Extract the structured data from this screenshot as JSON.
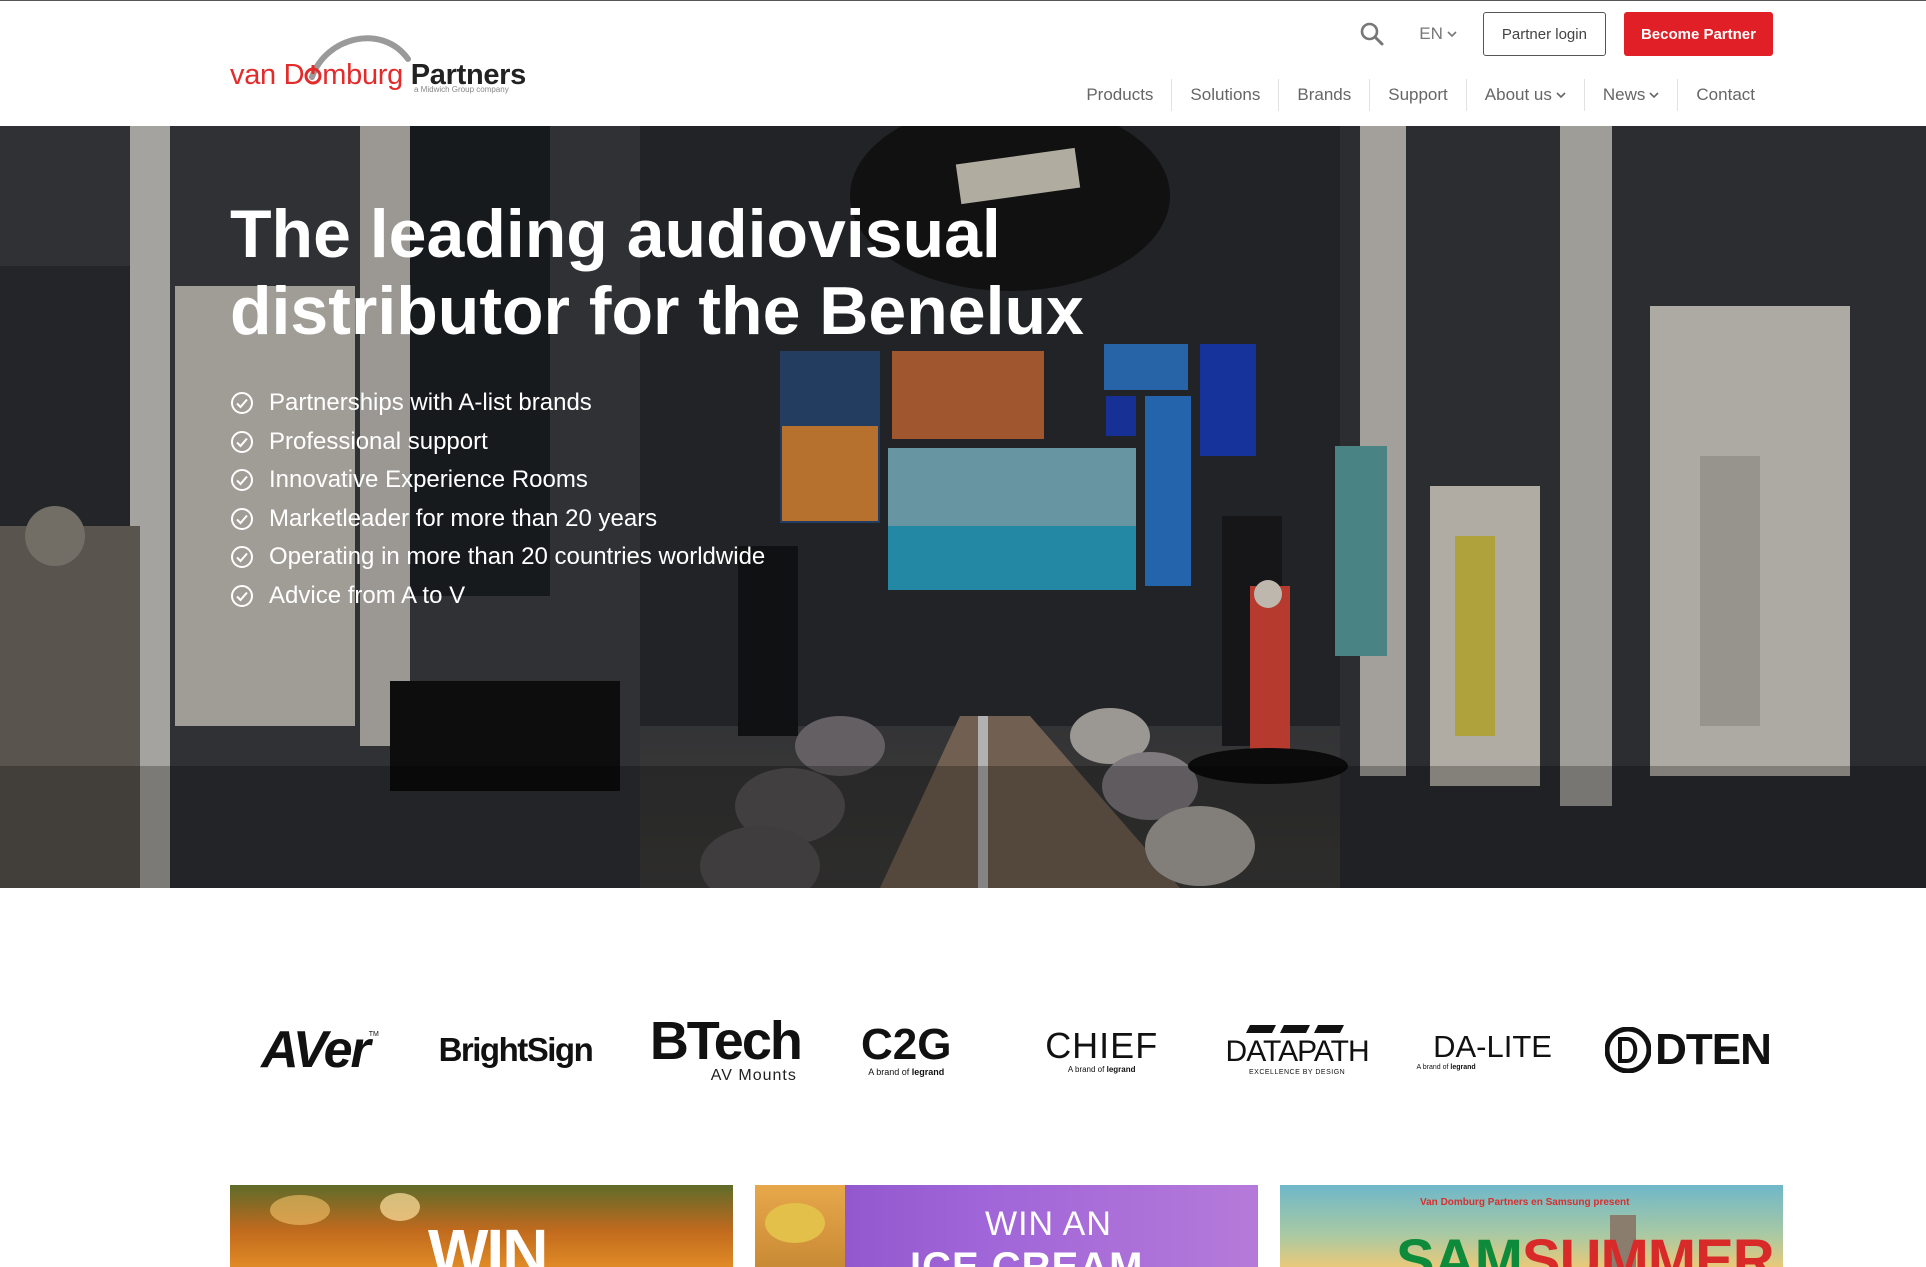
{
  "header": {
    "logo": {
      "part1": "van D",
      "part2": "mburg",
      "part3": " Partners",
      "tagline": "a Midwich Group company"
    },
    "icons": {
      "search": "search-icon",
      "chevron": "chevron-down-icon",
      "check": "check-circle-icon"
    },
    "language": "EN",
    "partner_login": "Partner login",
    "become_partner": "Become Partner",
    "nav": [
      {
        "label": "Products",
        "dropdown": false
      },
      {
        "label": "Solutions",
        "dropdown": false
      },
      {
        "label": "Brands",
        "dropdown": false
      },
      {
        "label": "Support",
        "dropdown": false
      },
      {
        "label": "About us",
        "dropdown": true
      },
      {
        "label": "News",
        "dropdown": true
      },
      {
        "label": "Contact",
        "dropdown": false
      }
    ]
  },
  "hero": {
    "title_line1": "The leading audiovisual",
    "title_line2": "distributor for the Benelux",
    "bullets": [
      "Partnerships with A-list brands",
      "Professional support",
      "Innovative Experience Rooms",
      "Marketleader for more than 20 years",
      "Operating in more than 20 countries worldwide",
      "Advice from A  to V"
    ]
  },
  "brands": {
    "aver": "AVer",
    "aver_tm": "TM",
    "brightsign": "BrightSign",
    "btech": "BTech",
    "btech_sub": "AV Mounts",
    "c2g": "C2G",
    "c2g_sub": "A brand of",
    "chief": "CHIEF",
    "chief_sub": "A brand of",
    "datapath": "DATAPATH",
    "datapath_sub": "EXCELLENCE BY DESIGN",
    "dalite": "DA-LITE",
    "dalite_sub": "A brand of",
    "dten": "DTEN",
    "legrand": "legrand"
  },
  "news": {
    "card1": "WIN",
    "card2_line1": "WIN AN",
    "card2_line2": "ICE CREAM",
    "card3_top": "Van Domburg Partners en Samsung present",
    "card3_sam": "SAM",
    "card3_summer": "SUMMER"
  },
  "colors": {
    "brand_red": "#e01f26",
    "logo_red": "#e32b2b",
    "nav_text": "#666666"
  }
}
